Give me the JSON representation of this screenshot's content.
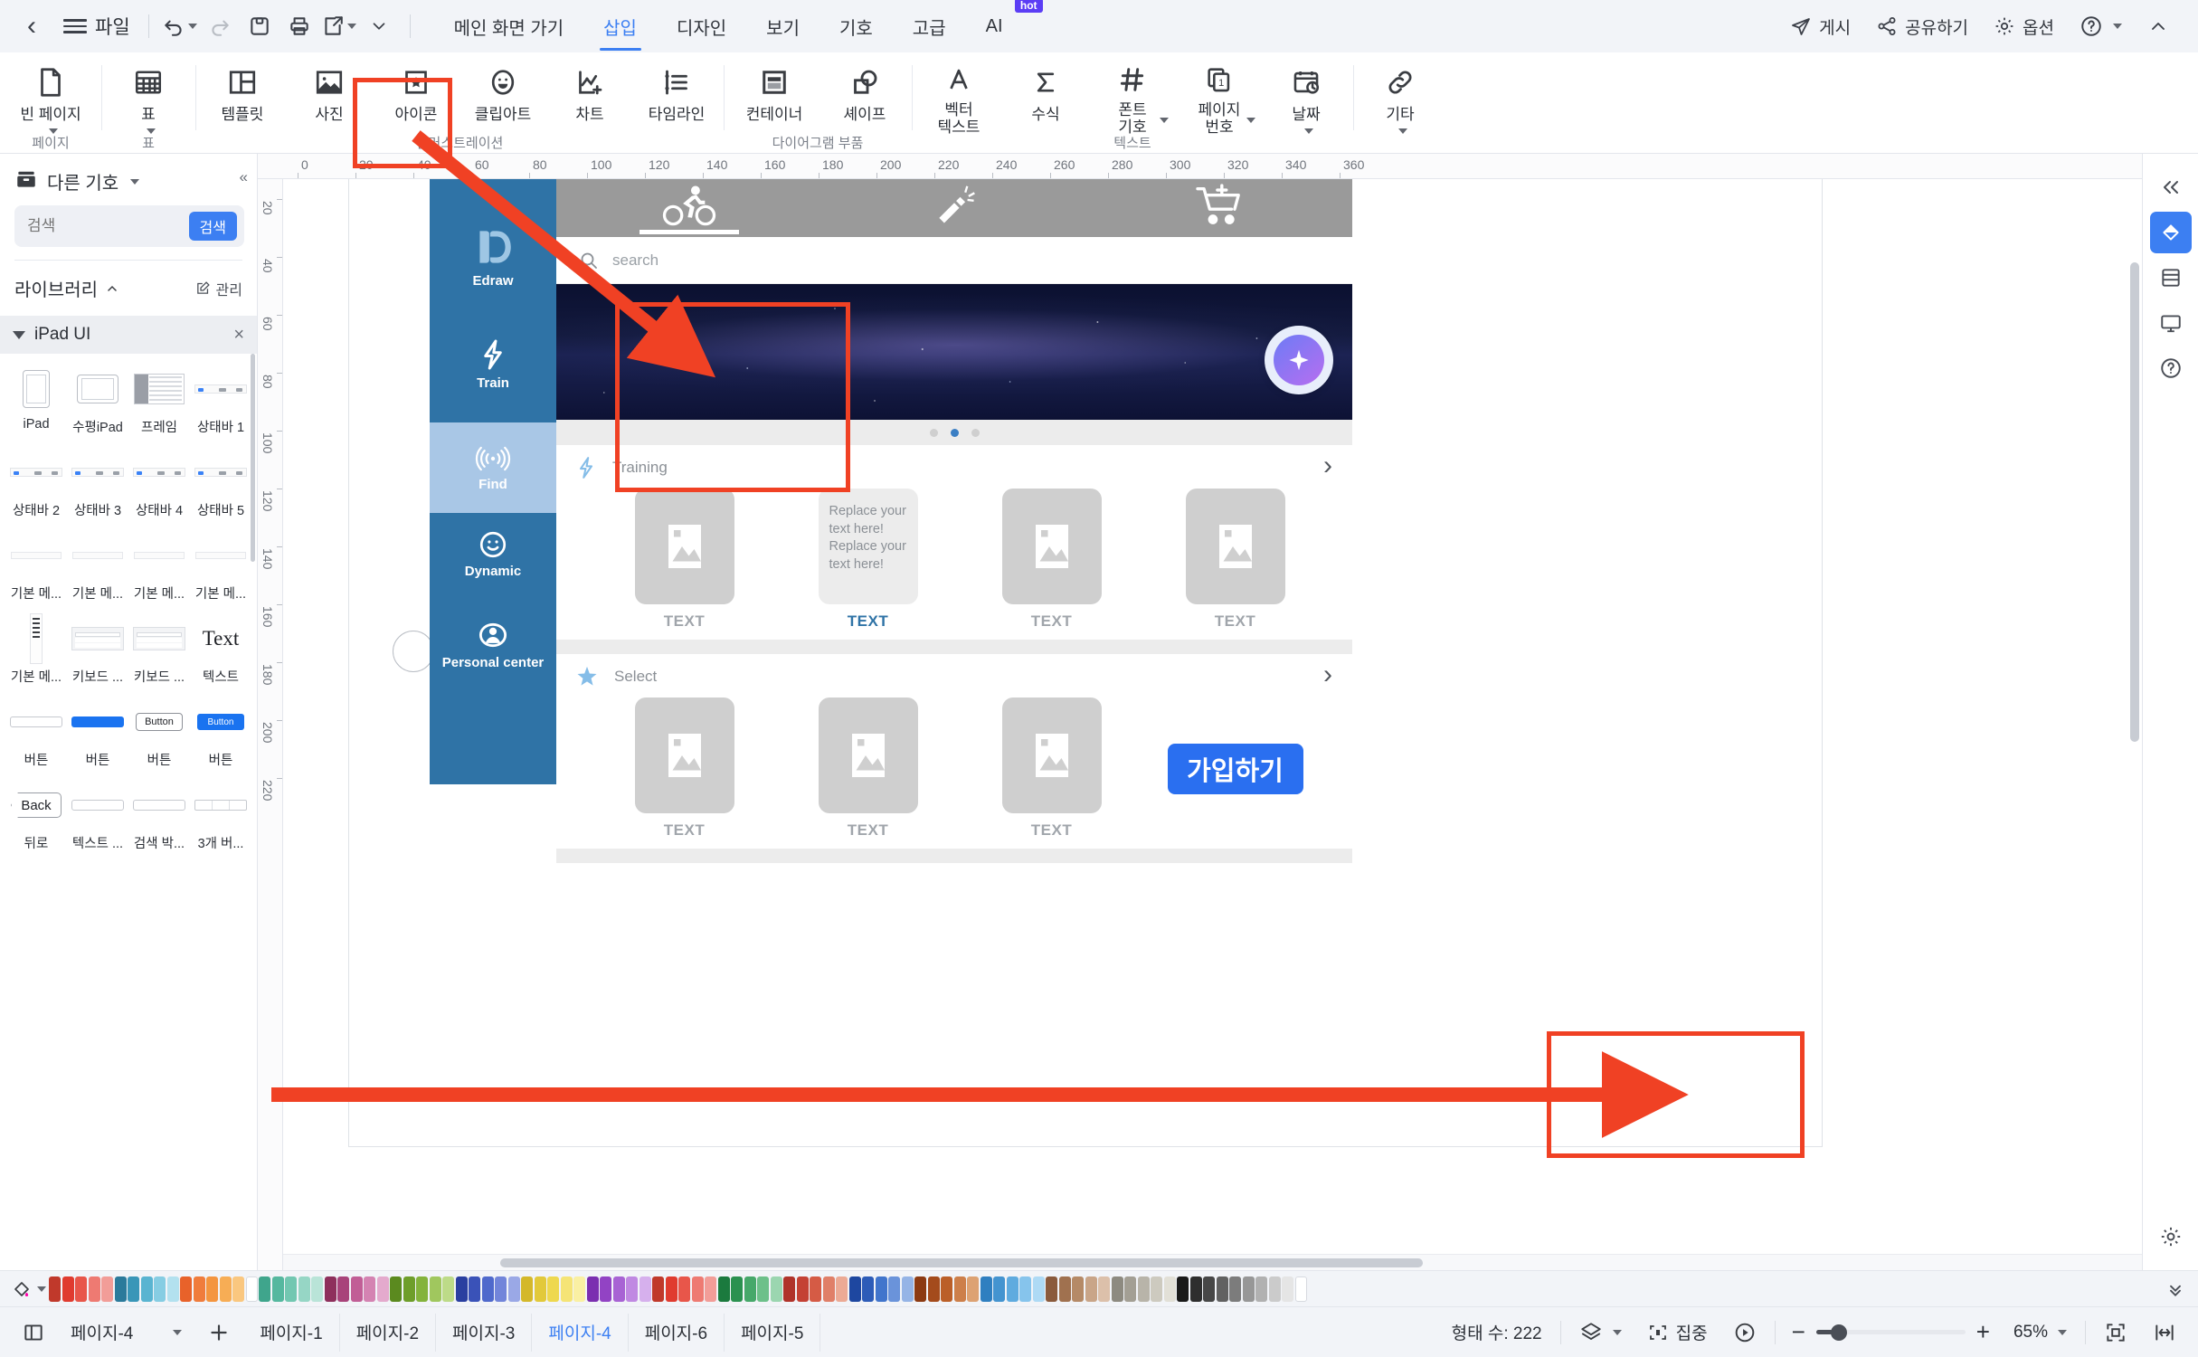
{
  "topbar": {
    "back_icon": "chevron-left-icon",
    "file_label": "파일",
    "quick": [
      {
        "name": "undo",
        "icon": "undo-icon",
        "has_caret": true
      },
      {
        "name": "redo",
        "icon": "redo-icon",
        "has_caret": false
      },
      {
        "name": "save",
        "icon": "save-icon",
        "has_caret": false
      },
      {
        "name": "print",
        "icon": "print-icon",
        "has_caret": false
      },
      {
        "name": "export",
        "icon": "export-icon",
        "has_caret": true
      },
      {
        "name": "customize",
        "icon": "chevron-down-icon",
        "has_caret": false
      }
    ],
    "tabs": [
      {
        "label": "메인 화면 가기",
        "active": false
      },
      {
        "label": "삽입",
        "active": true
      },
      {
        "label": "디자인",
        "active": false
      },
      {
        "label": "보기",
        "active": false
      },
      {
        "label": "기호",
        "active": false
      },
      {
        "label": "고급",
        "active": false
      },
      {
        "label": "AI",
        "active": false,
        "badge": "hot"
      }
    ],
    "right": [
      {
        "label": "게시",
        "icon": "publish-icon"
      },
      {
        "label": "공유하기",
        "icon": "share-icon"
      },
      {
        "label": "옵션",
        "icon": "gear-icon"
      },
      {
        "label": "",
        "icon": "help-icon",
        "caret": true
      },
      {
        "label": "",
        "icon": "collapse-ribbon-icon"
      }
    ]
  },
  "ribbon": {
    "groups": [
      {
        "caption": "페이지",
        "items": [
          {
            "label": "빈 페이지",
            "icon": "blank-page-icon",
            "caret": true
          }
        ]
      },
      {
        "caption": "표",
        "items": [
          {
            "label": "표",
            "icon": "table-icon",
            "caret": true
          }
        ]
      },
      {
        "caption": "일러스트레이션",
        "items": [
          {
            "label": "템플릿",
            "icon": "template-icon",
            "caret": false
          },
          {
            "label": "사진",
            "icon": "picture-icon",
            "caret": false,
            "highlighted": true
          },
          {
            "label": "아이콘",
            "icon": "icon-badge-icon",
            "caret": false
          },
          {
            "label": "클립아트",
            "icon": "clipart-smiley-icon",
            "caret": false
          },
          {
            "label": "차트",
            "icon": "chart-icon",
            "caret": false
          },
          {
            "label": "타임라인",
            "icon": "timeline-icon",
            "caret": false
          }
        ]
      },
      {
        "caption": "다이어그램 부품",
        "items": [
          {
            "label": "컨테이너",
            "icon": "container-icon",
            "caret": false
          },
          {
            "label": "셰이프",
            "icon": "shape-icon",
            "caret": false
          }
        ]
      },
      {
        "caption": "텍스트",
        "items": [
          {
            "label": "벡터",
            "label2": "텍스트",
            "icon": "vector-text-icon",
            "caret": false
          },
          {
            "label": "수식",
            "icon": "formula-icon",
            "caret": false
          },
          {
            "label": "폰트",
            "label2": "기호",
            "icon": "font-symbol-icon",
            "caret": true
          },
          {
            "label": "페이지",
            "label2": "번호",
            "icon": "page-number-icon",
            "caret": true
          },
          {
            "label": "날짜",
            "icon": "date-icon",
            "caret": true
          }
        ]
      },
      {
        "caption": "",
        "items": [
          {
            "label": "기타",
            "icon": "link-icon",
            "caret": true
          }
        ]
      }
    ]
  },
  "left_panel": {
    "title": "다른 기호",
    "title_icon": "library-box-icon",
    "collapse_icon": "double-chevron-left-icon",
    "search_placeholder": "검색",
    "search_button": "검색",
    "library_label": "라이브러리",
    "library_caret": "chevron-up-icon",
    "manage_label": "관리",
    "manage_icon": "edit-square-icon",
    "group_name": "iPad UI",
    "group_close": "×",
    "items": [
      {
        "label": "iPad",
        "thumb": "ipad-portrait"
      },
      {
        "label": "수평iPad",
        "thumb": "ipad-landscape"
      },
      {
        "label": "프레임",
        "thumb": "frame"
      },
      {
        "label": "상태바 1",
        "thumb": "statusbar"
      },
      {
        "label": "상태바 2",
        "thumb": "statusbar"
      },
      {
        "label": "상태바 3",
        "thumb": "statusbar"
      },
      {
        "label": "상태바 4",
        "thumb": "statusbar"
      },
      {
        "label": "상태바 5",
        "thumb": "statusbar"
      },
      {
        "label": "기본 메...",
        "thumb": "menu"
      },
      {
        "label": "기본 메...",
        "thumb": "menu"
      },
      {
        "label": "기본 메...",
        "thumb": "menu"
      },
      {
        "label": "기본 메...",
        "thumb": "menu"
      },
      {
        "label": "기본 메...",
        "thumb": "menu-vertical"
      },
      {
        "label": "키보드 ...",
        "thumb": "keyboard"
      },
      {
        "label": "키보드 ...",
        "thumb": "keyboard"
      },
      {
        "label": "텍스트",
        "thumb": "text"
      },
      {
        "label": "버튼",
        "thumb": "button-outline"
      },
      {
        "label": "버튼",
        "thumb": "button-blue"
      },
      {
        "label": "버튼",
        "thumb": "button-label"
      },
      {
        "label": "버튼",
        "thumb": "button-blue-label"
      },
      {
        "label": "뒤로",
        "thumb": "back"
      },
      {
        "label": "텍스트 ...",
        "thumb": "input"
      },
      {
        "label": "검색 박...",
        "thumb": "input"
      },
      {
        "label": "3개 버...",
        "thumb": "three-button"
      }
    ],
    "thumb_texts": {
      "text": "Text",
      "button": "Button",
      "back": "Back"
    }
  },
  "canvas": {
    "ruler_top": [
      "0",
      "20",
      "40",
      "60",
      "80",
      "100",
      "120",
      "140",
      "160",
      "180",
      "200",
      "220",
      "240",
      "260",
      "280",
      "300",
      "320",
      "340",
      "360"
    ],
    "ruler_left": [
      "20",
      "40",
      "60",
      "80",
      "100",
      "120",
      "140",
      "160",
      "180",
      "200",
      "220"
    ],
    "mockup": {
      "sidebar": [
        {
          "label": "Edraw",
          "icon": "edraw-logo-icon",
          "active": false
        },
        {
          "label": "Train",
          "icon": "lightning-icon",
          "active": false
        },
        {
          "label": "Find",
          "icon": "signal-icon",
          "active": true
        },
        {
          "label": "Dynamic",
          "icon": "smiley-icon",
          "active": false
        },
        {
          "label": "Personal center",
          "icon": "person-icon",
          "active": false
        }
      ],
      "topnav": [
        {
          "icon": "cyclist-icon",
          "active": true
        },
        {
          "icon": "torch-icon",
          "active": false
        },
        {
          "icon": "cart-plus-icon",
          "active": false
        }
      ],
      "search_placeholder": "search",
      "search_icon": "search-icon",
      "carousel_dots": 3,
      "carousel_active": 1,
      "sections": [
        {
          "icon": "lightning-icon",
          "title": "Training",
          "chevron": "chevron-right-icon",
          "cards": [
            {
              "type": "image",
              "caption": "TEXT",
              "caption_blue": false
            },
            {
              "type": "text",
              "body": "Replace your text here!\nReplace your text here!",
              "caption": "TEXT",
              "caption_blue": true
            },
            {
              "type": "image",
              "caption": "TEXT",
              "caption_blue": false
            },
            {
              "type": "image",
              "caption": "TEXT",
              "caption_blue": false
            }
          ]
        },
        {
          "icon": "star-icon",
          "title": "Select",
          "chevron": "chevron-right-icon",
          "cards": [
            {
              "type": "image",
              "caption": "TEXT",
              "caption_blue": false
            },
            {
              "type": "image",
              "caption": "TEXT",
              "caption_blue": false
            },
            {
              "type": "image",
              "caption": "TEXT",
              "caption_blue": false
            },
            {
              "type": "button",
              "label": "가입하기"
            }
          ]
        }
      ]
    }
  },
  "right_rail": [
    {
      "icon": "fill-style-icon",
      "active": true,
      "name": "fill-panel"
    },
    {
      "icon": "page-layout-icon",
      "active": false,
      "name": "page-panel"
    },
    {
      "icon": "presentation-icon",
      "active": false,
      "name": "presentation-panel"
    },
    {
      "icon": "help-circle-icon",
      "active": false,
      "name": "help-panel"
    },
    {
      "icon": "gear-icon",
      "active": false,
      "name": "settings-panel"
    }
  ],
  "statusbar": {
    "view_icon": "page-view-icon",
    "current_page": "페이지-4",
    "add_icon": "plus-icon",
    "page_tabs": [
      {
        "label": "페이지-1",
        "active": false
      },
      {
        "label": "페이지-2",
        "active": false
      },
      {
        "label": "페이지-3",
        "active": false
      },
      {
        "label": "페이지-4",
        "active": true
      },
      {
        "label": "페이지-6",
        "active": false
      },
      {
        "label": "페이지-5",
        "active": false
      }
    ],
    "shape_count": "형태 수: 222",
    "layer_icon": "layers-icon",
    "focus_label": "집중",
    "focus_icon": "focus-icon",
    "play_icon": "play-icon",
    "zoom_minus": "−",
    "zoom_plus": "+",
    "zoom_level": "65%",
    "fit_page_icon": "fit-page-icon",
    "fit_width_icon": "fit-width-icon"
  },
  "colors": {
    "accent": "#3c7ff2",
    "highlight": "#f04124",
    "mock_blue": "#2f73a6",
    "mock_blue_active": "#a9c7e6",
    "signup_blue": "#2a6ff0",
    "topbar_bg": "#f2f4f8"
  },
  "palette": [
    "#c0392b",
    "#e03b2f",
    "#e8564a",
    "#ee7a72",
    "#f29d98",
    "#2b7a9b",
    "#3996b8",
    "#59b4d1",
    "#86cde3",
    "#b3e1ef",
    "#e8622a",
    "#f07c3c",
    "#f4953f",
    "#f7ad55",
    "#fac77f",
    "#ffffff",
    "#3fa58c",
    "#55b89f",
    "#72c7b1",
    "#96d6c5",
    "#b9e4d8",
    "#8e2f5c",
    "#a8437a",
    "#c15e96",
    "#d483b2",
    "#e4aacd",
    "#5b8a1f",
    "#6e9e2a",
    "#84b33c",
    "#a0c75e",
    "#bddb88",
    "#2a3fa0",
    "#3a52b8",
    "#4f69cc",
    "#7285da",
    "#9aa8e6",
    "#d4b82a",
    "#e2c93a",
    "#eed84f",
    "#f5e476",
    "#faf0a3",
    "#7b2fb0",
    "#9243c4",
    "#a863d4",
    "#c089e2",
    "#d6b0ed",
    "#c0392b",
    "#e03b2f",
    "#e8564a",
    "#ee7a72",
    "#f29d98",
    "#1b7a3e",
    "#2b9150",
    "#46a86a",
    "#6dc08a",
    "#9bd6b0",
    "#b0332a",
    "#c44134",
    "#d55b45",
    "#e07f68",
    "#ecaa95",
    "#1e47a0",
    "#2d5cb8",
    "#4175cc",
    "#6a93da",
    "#95b4e6",
    "#8c3a12",
    "#a44b1c",
    "#bb5f28",
    "#cd7f4a",
    "#ddA273",
    "#2f7fc0",
    "#4494d0",
    "#5fabdf",
    "#86c4ec",
    "#aedaf5",
    "#8a5a3c",
    "#a0714f",
    "#b58a67",
    "#c9a588",
    "#dcc0aa",
    "#8d8a80",
    "#a39f94",
    "#b8b4a9",
    "#cdcabf",
    "#e2e0d7",
    "#1a1a1a",
    "#2e2e2e",
    "#474747",
    "#616161",
    "#7c7c7c",
    "#979797",
    "#b1b1b1",
    "#cbcbcb",
    "#e5e5e5",
    "#ffffff"
  ]
}
